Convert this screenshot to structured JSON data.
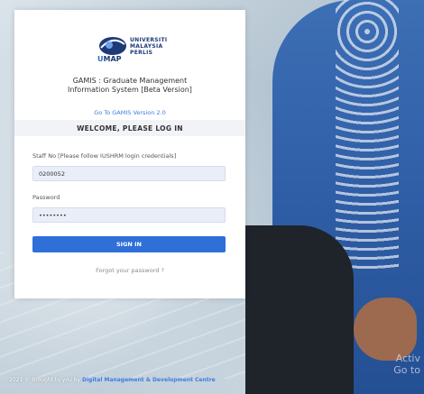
{
  "logo": {
    "university_line1": "UNIVERSITI",
    "university_line2": "MALAYSIA",
    "university_line3": "PERLIS",
    "acronym_u": "U",
    "acronym_rest": "MAP"
  },
  "system_title_line1": "GAMIS : Graduate Management",
  "system_title_line2": "Information System [Beta Version]",
  "gamis_link": "Go To GAMIS Version 2.0",
  "welcome": "WELCOME, PLEASE LOG IN",
  "staff_label": "Staff No [Please follow IUSHRM login credentials]",
  "staff_value": "0200052",
  "password_label": "Password",
  "password_value": "••••••••",
  "signin_label": "SIGN IN",
  "forgot_label": "Forgot your password ?",
  "footer": {
    "prefix": "2021 © Brought to you by ",
    "link": "Digital Management & Development Centre"
  },
  "watermark_line1": "Activ",
  "watermark_line2": "Go to"
}
